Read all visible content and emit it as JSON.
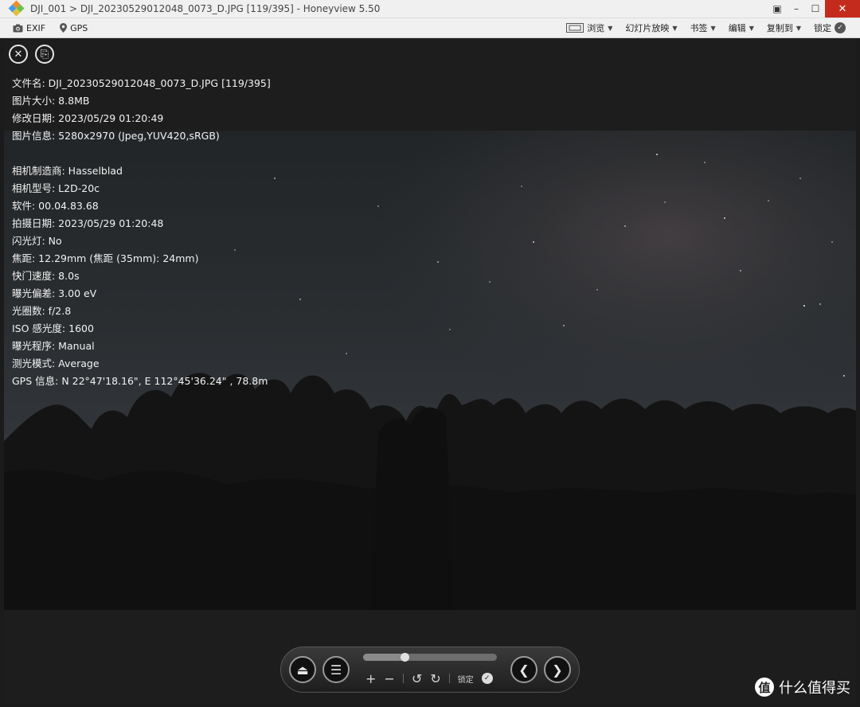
{
  "window": {
    "title": "DJI_001 > DJI_20230529012048_0073_D.JPG [119/395] - Honeyview 5.50",
    "controls": {
      "fullscreen": "▣",
      "minimize": "–",
      "maximize": "☐",
      "close": "✕"
    }
  },
  "toolbar": {
    "exif_label": "EXIF",
    "gps_label": "GPS",
    "browse_label": "浏览",
    "slideshow_label": "幻灯片放映",
    "bookmark_label": "书签",
    "edit_label": "编辑",
    "copy_label": "复制到",
    "lock_label": "锁定"
  },
  "overlay": {
    "close_glyph": "✕",
    "copy_glyph": "⎘"
  },
  "info": {
    "filename": "文件名: DJI_20230529012048_0073_D.JPG [119/395]",
    "size": "图片大小: 8.8MB",
    "modified": "修改日期: 2023/05/29 01:20:49",
    "image_info": "图片信息: 5280x2970 (Jpeg,YUV420,sRGB)",
    "maker": "相机制造商: Hasselblad",
    "model": "相机型号: L2D-20c",
    "software": "软件: 00.04.83.68",
    "shot_date": "拍摄日期: 2023/05/29 01:20:48",
    "flash": "闪光灯: No",
    "focal": "焦距: 12.29mm (焦距 (35mm): 24mm)",
    "shutter": "快门速度: 8.0s",
    "exposure_bias": "曝光偏差: 3.00 eV",
    "aperture": "光圈数: f/2.8",
    "iso": "ISO 感光度: 1600",
    "program": "曝光程序: Manual",
    "metering": "测光模式: Average",
    "gps": "GPS 信息: N 22°47'18.16\", E 112°45'36.24\" , 78.8m"
  },
  "controls": {
    "eject_glyph": "⏏",
    "menu_glyph": "☰",
    "zoom_in": "+",
    "zoom_out": "−",
    "rotate_left": "↺",
    "rotate_right": "↻",
    "lock_label": "锁定",
    "prev_glyph": "❮",
    "next_glyph": "❯",
    "position_fraction": 0.31
  },
  "watermark": {
    "icon": "值",
    "text": "什么值得买"
  }
}
